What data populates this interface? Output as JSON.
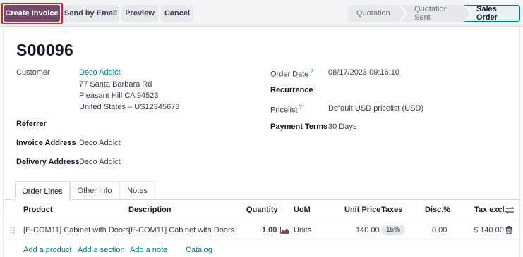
{
  "toolbar": {
    "create_invoice": "Create Invoice",
    "send_by_email": "Send by Email",
    "preview": "Preview",
    "cancel": "Cancel"
  },
  "statusbar": {
    "stages": [
      "Quotation",
      "Quotation Sent",
      "Sales Order"
    ],
    "active": "Sales Order"
  },
  "record": {
    "name": "S00096"
  },
  "left_fields": {
    "customer_label": "Customer",
    "customer_name": "Deco Addict",
    "customer_address": [
      "77 Santa Barbara Rd",
      "Pleasant Hill CA 94523",
      "United States – US12345673"
    ],
    "referrer_label": "Referrer",
    "invoice_address_label": "Invoice Address",
    "invoice_address": "Deco Addict",
    "delivery_address_label": "Delivery Address",
    "delivery_address": "Deco Addict"
  },
  "right_fields": {
    "order_date_label": "Order Date",
    "order_date": "08/17/2023 09:16:10",
    "recurrence_label": "Recurrence",
    "pricelist_label": "Pricelist",
    "pricelist": "Default USD pricelist (USD)",
    "payment_terms_label": "Payment Terms",
    "payment_terms": "30 Days",
    "help_mark": "?"
  },
  "tabs": [
    "Order Lines",
    "Other Info",
    "Notes"
  ],
  "table": {
    "headers": {
      "product": "Product",
      "description": "Description",
      "quantity": "Quantity",
      "uom": "UoM",
      "unit_price": "Unit Price",
      "taxes": "Taxes",
      "discount": "Disc.%",
      "tax_excl": "Tax excl."
    },
    "rows": [
      {
        "product": "[E-COM11] Cabinet with Doors",
        "description": "[E-COM11] Cabinet with Doors",
        "quantity": "1.00",
        "uom": "Units",
        "unit_price": "140.00",
        "taxes": "15%",
        "discount": "0.00",
        "tax_excl": "$ 140.00"
      }
    ],
    "actions": [
      "Add a product",
      "Add a section",
      "Add a note",
      "Catalog"
    ]
  },
  "colors": {
    "primary": "#714b67",
    "link": "#017e84",
    "highlight": "#e01b1b"
  }
}
